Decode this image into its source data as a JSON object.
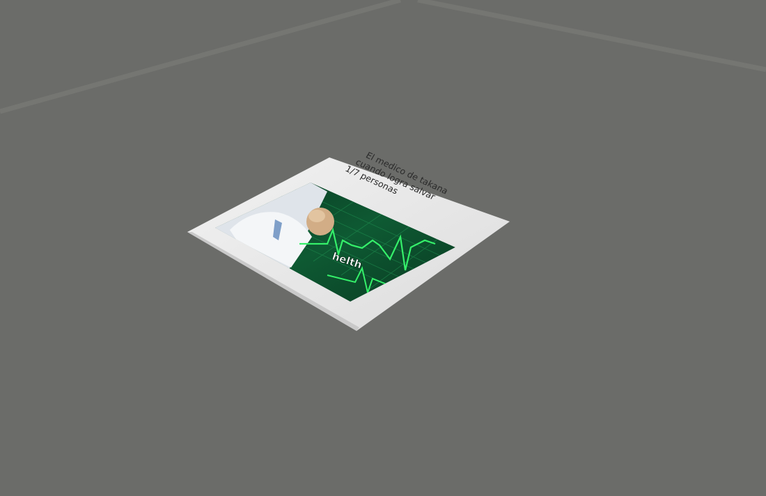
{
  "scene": {
    "background_color": "#6b6c69",
    "floor_line_color": "#7b7c79"
  },
  "meme": {
    "caption_lines": [
      "El medico de takana",
      "cuando logra salvar",
      "1/7 personas"
    ],
    "sticker_label": "helth",
    "colors": {
      "card_border": "#e6e6e6",
      "monitor_bg": "#0c4a2c",
      "ecg_line": "#35f06a",
      "caption": "#2a2a2a"
    }
  }
}
